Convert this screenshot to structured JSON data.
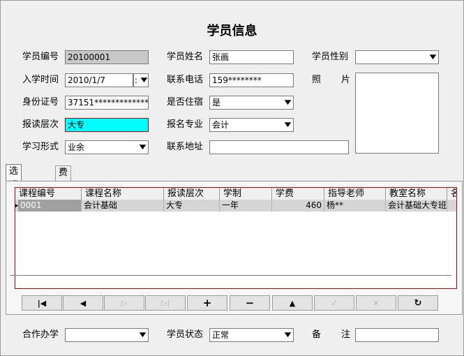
{
  "form": {
    "title": "学员信息",
    "student_id_label": "学员编号",
    "student_id_value": "20100001",
    "student_name_label": "学员姓名",
    "student_name_value": "张画",
    "gender_label": "学员性别",
    "gender_value": "",
    "enroll_date_label": "入学时间",
    "enroll_date_value": "2010/1/7",
    "enroll_time_value": ":",
    "phone_label": "联系电话",
    "phone_value": "159********",
    "photo_label_1": "照",
    "photo_label_2": "片",
    "id_card_label": "身份证号",
    "id_card_value": "37151**************",
    "boarding_label": "是否住宿",
    "boarding_value": "是",
    "level_label": "报读层次",
    "level_value": "大专",
    "major_label": "报名专业",
    "major_value": "会计",
    "study_mode_label": "学习形式",
    "study_mode_value": "业余",
    "address_label": "联系地址",
    "address_value": ""
  },
  "tabs": [
    {
      "label": "选课明细"
    },
    {
      "label": "费用明细"
    }
  ],
  "grid": {
    "columns": [
      "课程编号",
      "课程名称",
      "报读层次",
      "学制",
      "学费",
      "指导老师",
      "教室名称",
      "名"
    ],
    "rows": [
      {
        "course_id": "0001",
        "course_name": "会计基础",
        "level": "大专",
        "duration": "一年",
        "fee": "460",
        "teacher": "杨**",
        "classroom": "会计基础大专班"
      }
    ]
  },
  "nav": {
    "first_icon": "first-record-icon",
    "prev_icon": "previous-record-icon",
    "next_icon": "next-record-icon",
    "last_icon": "last-record-icon",
    "add_icon": "add-icon",
    "delete_icon": "delete-icon",
    "edit_icon": "edit-icon",
    "post_icon": "post-icon",
    "cancel_icon": "cancel-icon",
    "refresh_icon": "refresh-icon"
  },
  "footer": {
    "cooperation_label": "合作办学",
    "cooperation_value": "",
    "status_label": "学员状态",
    "status_value": "正常",
    "remark_label_1": "备",
    "remark_label_2": "注",
    "remark_value": ""
  },
  "colors": {
    "highlight": "#00ffff",
    "focus_border": "#c00000",
    "readonly": "#c8c8c8",
    "window_bg": "#f0f0f0"
  }
}
